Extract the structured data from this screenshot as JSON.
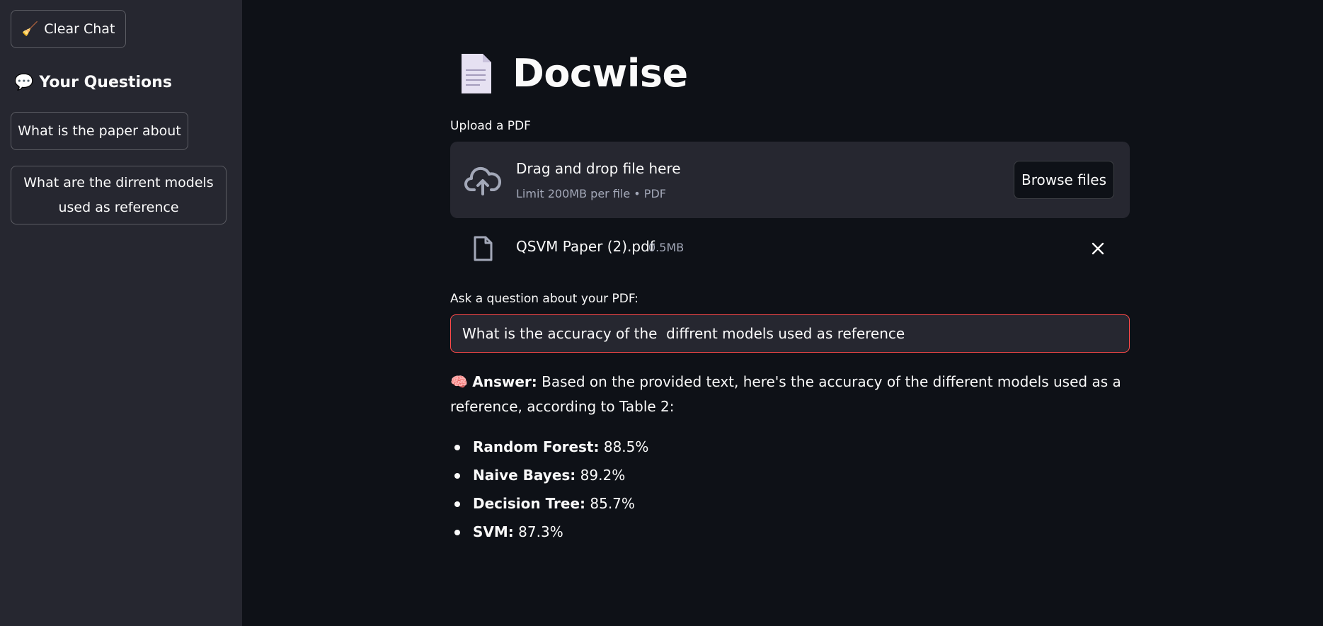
{
  "sidebar": {
    "clear_button": {
      "icon": "broom-icon",
      "label": "Clear Chat"
    },
    "heading": {
      "icon": "speech-bubble-icon",
      "label": "Your Questions"
    },
    "questions": [
      {
        "label": "What is the paper about"
      },
      {
        "label": "What are the dirrent models used as reference"
      }
    ]
  },
  "header": {
    "icon": "document-icon",
    "title": "Docwise"
  },
  "upload": {
    "label": "Upload a PDF",
    "dropzone_title": "Drag and drop file here",
    "dropzone_subtitle": "Limit 200MB per file • PDF",
    "browse_label": "Browse files",
    "file": {
      "name": "QSVM Paper (2).pdf",
      "size": "0.5MB"
    }
  },
  "question": {
    "label": "Ask a question about your PDF:",
    "value": "What is the accuracy of the  diffrent models used as reference"
  },
  "answer": {
    "icon": "brain-icon",
    "prefix": "Answer:",
    "text": "Based on the provided text, here's the accuracy of the different models used as a reference, according to Table 2:",
    "items": [
      {
        "model": "Random Forest:",
        "value": "88.5%"
      },
      {
        "model": "Naive Bayes:",
        "value": "89.2%"
      },
      {
        "model": "Decision Tree:",
        "value": "85.7%"
      },
      {
        "model": "SVM:",
        "value": "87.3%"
      }
    ]
  },
  "colors": {
    "background": "#0e1117",
    "sidebar": "#262730",
    "accent": "#ff4b4b",
    "text": "#fafafa"
  }
}
